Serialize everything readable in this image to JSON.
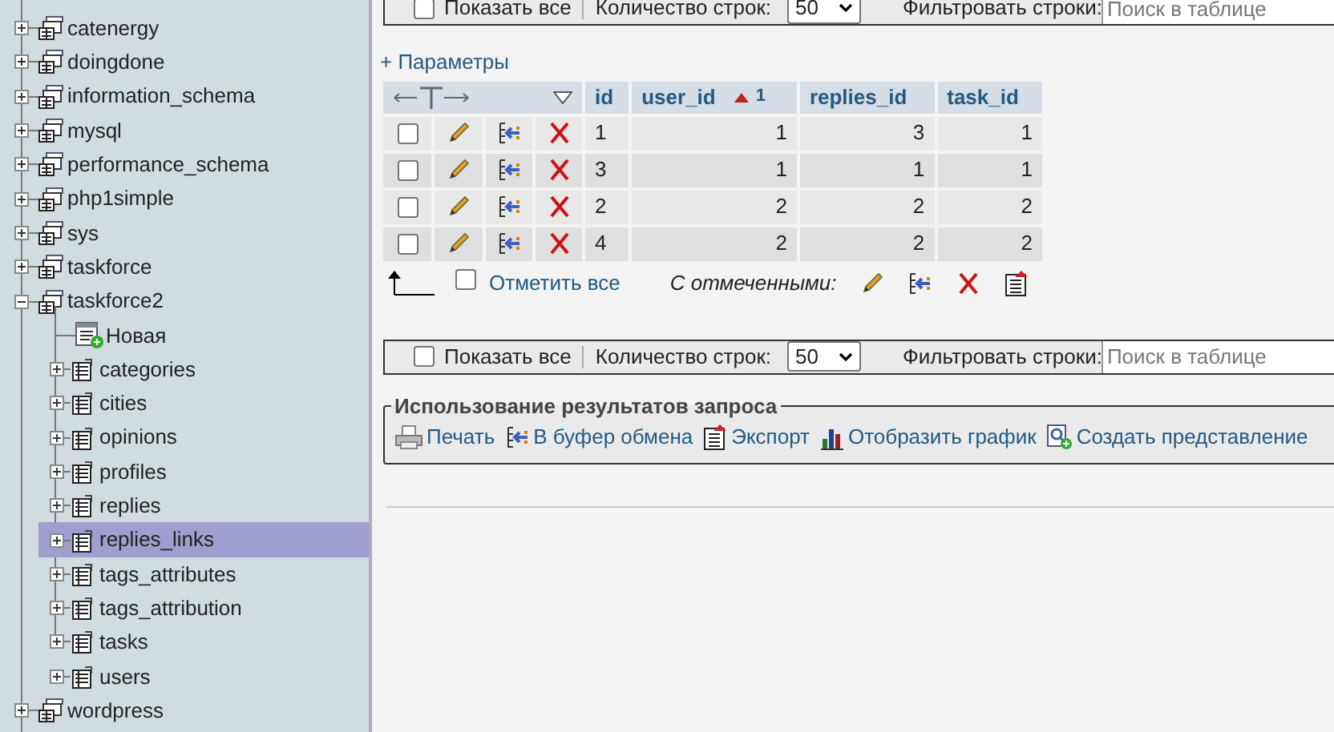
{
  "sidebar": {
    "items": [
      {
        "label": "catenergy",
        "kind": "database",
        "expanded": false
      },
      {
        "label": "doingdone",
        "kind": "database",
        "expanded": false
      },
      {
        "label": "information_schema",
        "kind": "database",
        "expanded": false
      },
      {
        "label": "mysql",
        "kind": "database",
        "expanded": false
      },
      {
        "label": "performance_schema",
        "kind": "database",
        "expanded": false
      },
      {
        "label": "php1simple",
        "kind": "database",
        "expanded": false
      },
      {
        "label": "sys",
        "kind": "database",
        "expanded": false
      },
      {
        "label": "taskforce",
        "kind": "database",
        "expanded": false
      },
      {
        "label": "taskforce2",
        "kind": "database",
        "expanded": true,
        "children": [
          {
            "label": "Новая",
            "kind": "new"
          },
          {
            "label": "categories",
            "kind": "table",
            "selected": false
          },
          {
            "label": "cities",
            "kind": "table",
            "selected": false
          },
          {
            "label": "opinions",
            "kind": "table",
            "selected": false
          },
          {
            "label": "profiles",
            "kind": "table",
            "selected": false
          },
          {
            "label": "replies",
            "kind": "table",
            "selected": false
          },
          {
            "label": "replies_links",
            "kind": "table",
            "selected": true
          },
          {
            "label": "tags_attributes",
            "kind": "table",
            "selected": false
          },
          {
            "label": "tags_attribution",
            "kind": "table",
            "selected": false
          },
          {
            "label": "tasks",
            "kind": "table",
            "selected": false
          },
          {
            "label": "users",
            "kind": "table",
            "selected": false
          }
        ]
      },
      {
        "label": "wordpress",
        "kind": "database",
        "expanded": false
      }
    ]
  },
  "nav_bars": [
    {
      "show_all": "Показать все",
      "show_all_checked": false,
      "rows_label": "Количество строк:",
      "rows_value": "50",
      "filter_label": "Фильтровать строки:",
      "filter_placeholder": "Поиск в таблице"
    },
    {
      "show_all": "Показать все",
      "show_all_checked": false,
      "rows_label": "Количество строк:",
      "rows_value": "50",
      "filter_label": "Фильтровать строки:",
      "filter_placeholder": "Поиск в таблице"
    }
  ],
  "options_link": "+ Параметры",
  "table": {
    "columns": [
      {
        "label": "id",
        "sorted": false
      },
      {
        "label": "user_id",
        "sorted": true,
        "sort_order": "1"
      },
      {
        "label": "replies_id",
        "sorted": false
      },
      {
        "label": "task_id",
        "sorted": false
      }
    ],
    "rows": [
      {
        "checked": false,
        "cells": [
          "1",
          "1",
          "3",
          "1"
        ]
      },
      {
        "checked": false,
        "cells": [
          "3",
          "1",
          "1",
          "1"
        ]
      },
      {
        "checked": false,
        "cells": [
          "2",
          "2",
          "2",
          "2"
        ]
      },
      {
        "checked": false,
        "cells": [
          "4",
          "2",
          "2",
          "2"
        ]
      }
    ]
  },
  "table_footer": {
    "check_all": "Отметить все",
    "check_all_checked": false,
    "with_selected": "С отмеченными:"
  },
  "query_results": {
    "legend": "Использование результатов запроса",
    "actions": [
      {
        "label": "Печать",
        "kind": "print"
      },
      {
        "label": "В буфер обмена",
        "kind": "copy"
      },
      {
        "label": "Экспорт",
        "kind": "export"
      },
      {
        "label": "Отобразить график",
        "kind": "chart"
      },
      {
        "label": "Создать представление",
        "kind": "view"
      }
    ]
  }
}
